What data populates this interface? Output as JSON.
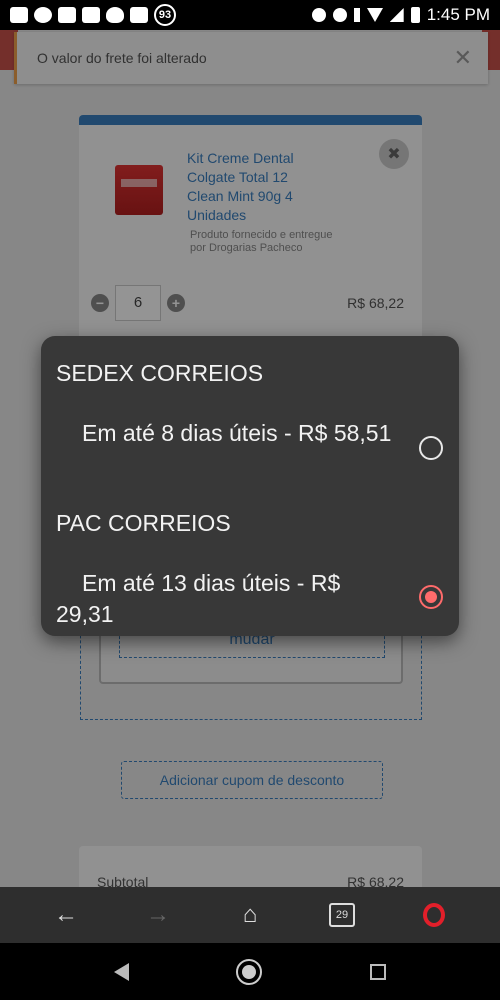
{
  "status_bar": {
    "time": "1:45 PM",
    "notification_count": "93"
  },
  "toast": {
    "message": "O valor do frete foi alterado",
    "close_symbol": "✕"
  },
  "product": {
    "title": "Kit Creme Dental Colgate Total 12 Clean Mint 90g 4 Unidades",
    "seller": "Produto fornecido e entregue por Drogarias Pacheco",
    "quantity": "6",
    "price": "R$ 68,22",
    "remove_symbol": "✖",
    "minus_symbol": "−",
    "plus_symbol": "+"
  },
  "shipping": {
    "change_label": "mudar"
  },
  "coupon": {
    "label": "Adicionar cupom de desconto"
  },
  "summary": {
    "subtotal_label": "Subtotal",
    "subtotal_value": "R$ 68,22"
  },
  "shipping_dialog": {
    "options": [
      {
        "group": "SEDEX CORREIOS",
        "label": "Em até 8 dias úteis - R$ 58,51",
        "selected": false
      },
      {
        "group": "PAC CORREIOS",
        "label": "Em até 13 dias úteis - R$ 29,31",
        "selected": true
      }
    ]
  },
  "browser_bar": {
    "back_symbol": "←",
    "forward_symbol": "→",
    "home_symbol": "⌂",
    "tabs_count": "29"
  },
  "colors": {
    "accent_blue": "#3a7fc0",
    "selected_red": "#ff6b6b",
    "dialog_bg": "#383838",
    "opera_red": "#e21f2a"
  }
}
